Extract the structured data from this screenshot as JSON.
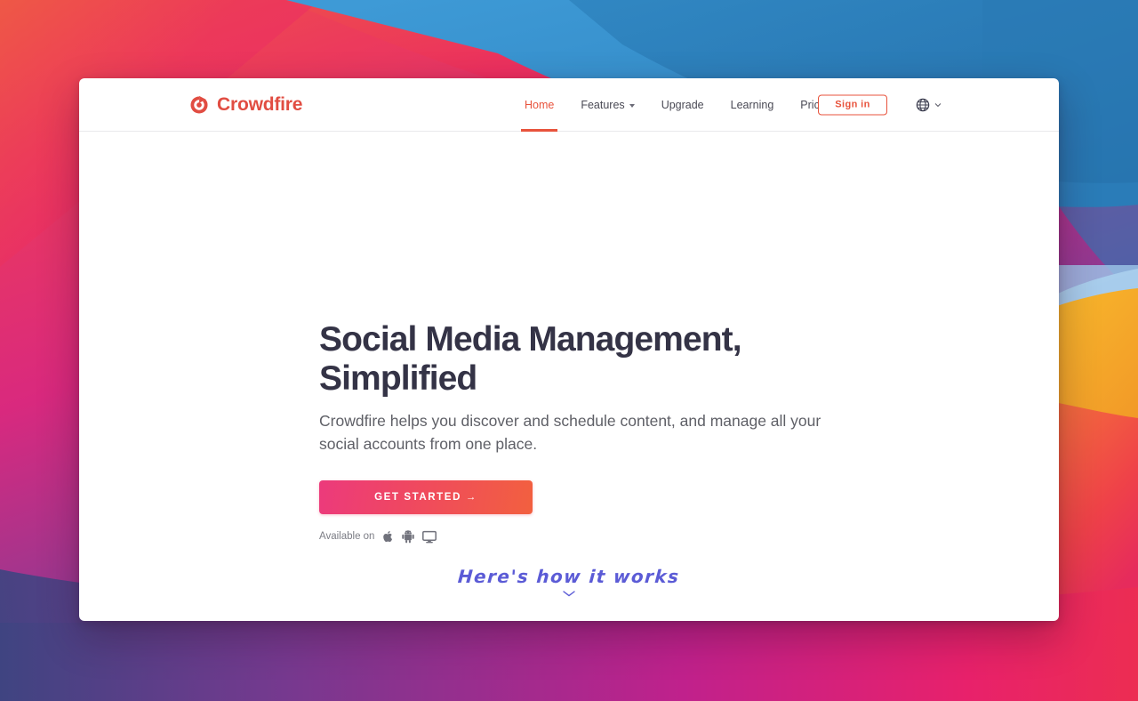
{
  "desktop": {
    "wallpaper_name": "bigsur-gradient-wallpaper",
    "colors": {
      "top_left_red": "#e8484f",
      "top_pink": "#ec2f62",
      "blue_dark": "#2478b5",
      "blue_mid": "#3a94cf",
      "blue_light": "#cfe2f5",
      "yellow": "#f5ab26",
      "orange": "#f2683c",
      "magenta": "#d4218a",
      "purple": "#6b3e92",
      "indigo": "#42417f"
    }
  },
  "browser": {
    "window_name": "crowdfire-landing-page"
  },
  "header": {
    "brand": {
      "name": "Crowdfire",
      "logo_icon": "crowdfire-swirl-icon",
      "color": "#e14d42"
    },
    "nav": [
      {
        "label": "Home",
        "active": true,
        "has_dropdown": false
      },
      {
        "label": "Features",
        "active": false,
        "has_dropdown": true
      },
      {
        "label": "Upgrade",
        "active": false,
        "has_dropdown": false
      },
      {
        "label": "Learning",
        "active": false,
        "has_dropdown": false
      },
      {
        "label": "Pricing",
        "active": false,
        "has_dropdown": false
      }
    ],
    "signin_label": "Sign in",
    "signin_color": "#e8533c",
    "language": {
      "icon": "globe-icon",
      "caret_icon": "chevron-down-icon"
    }
  },
  "hero": {
    "headline": "Social Media Management,\nSimplified",
    "headline_color": "#343346",
    "subheadline": "Crowdfire helps you discover and schedule content, and manage all your\nsocial accounts from one place.",
    "cta_label": "GET STARTED →",
    "cta_gradient_from": "#ec3a7c",
    "cta_gradient_to": "#f2603f",
    "available": {
      "label": "Available on",
      "platforms": [
        "apple-icon",
        "android-icon",
        "desktop-monitor-icon"
      ]
    },
    "how_it_works": {
      "text": "Here's how it works",
      "color": "#5b5bd6",
      "chevron_icon": "chevron-down-icon"
    }
  }
}
